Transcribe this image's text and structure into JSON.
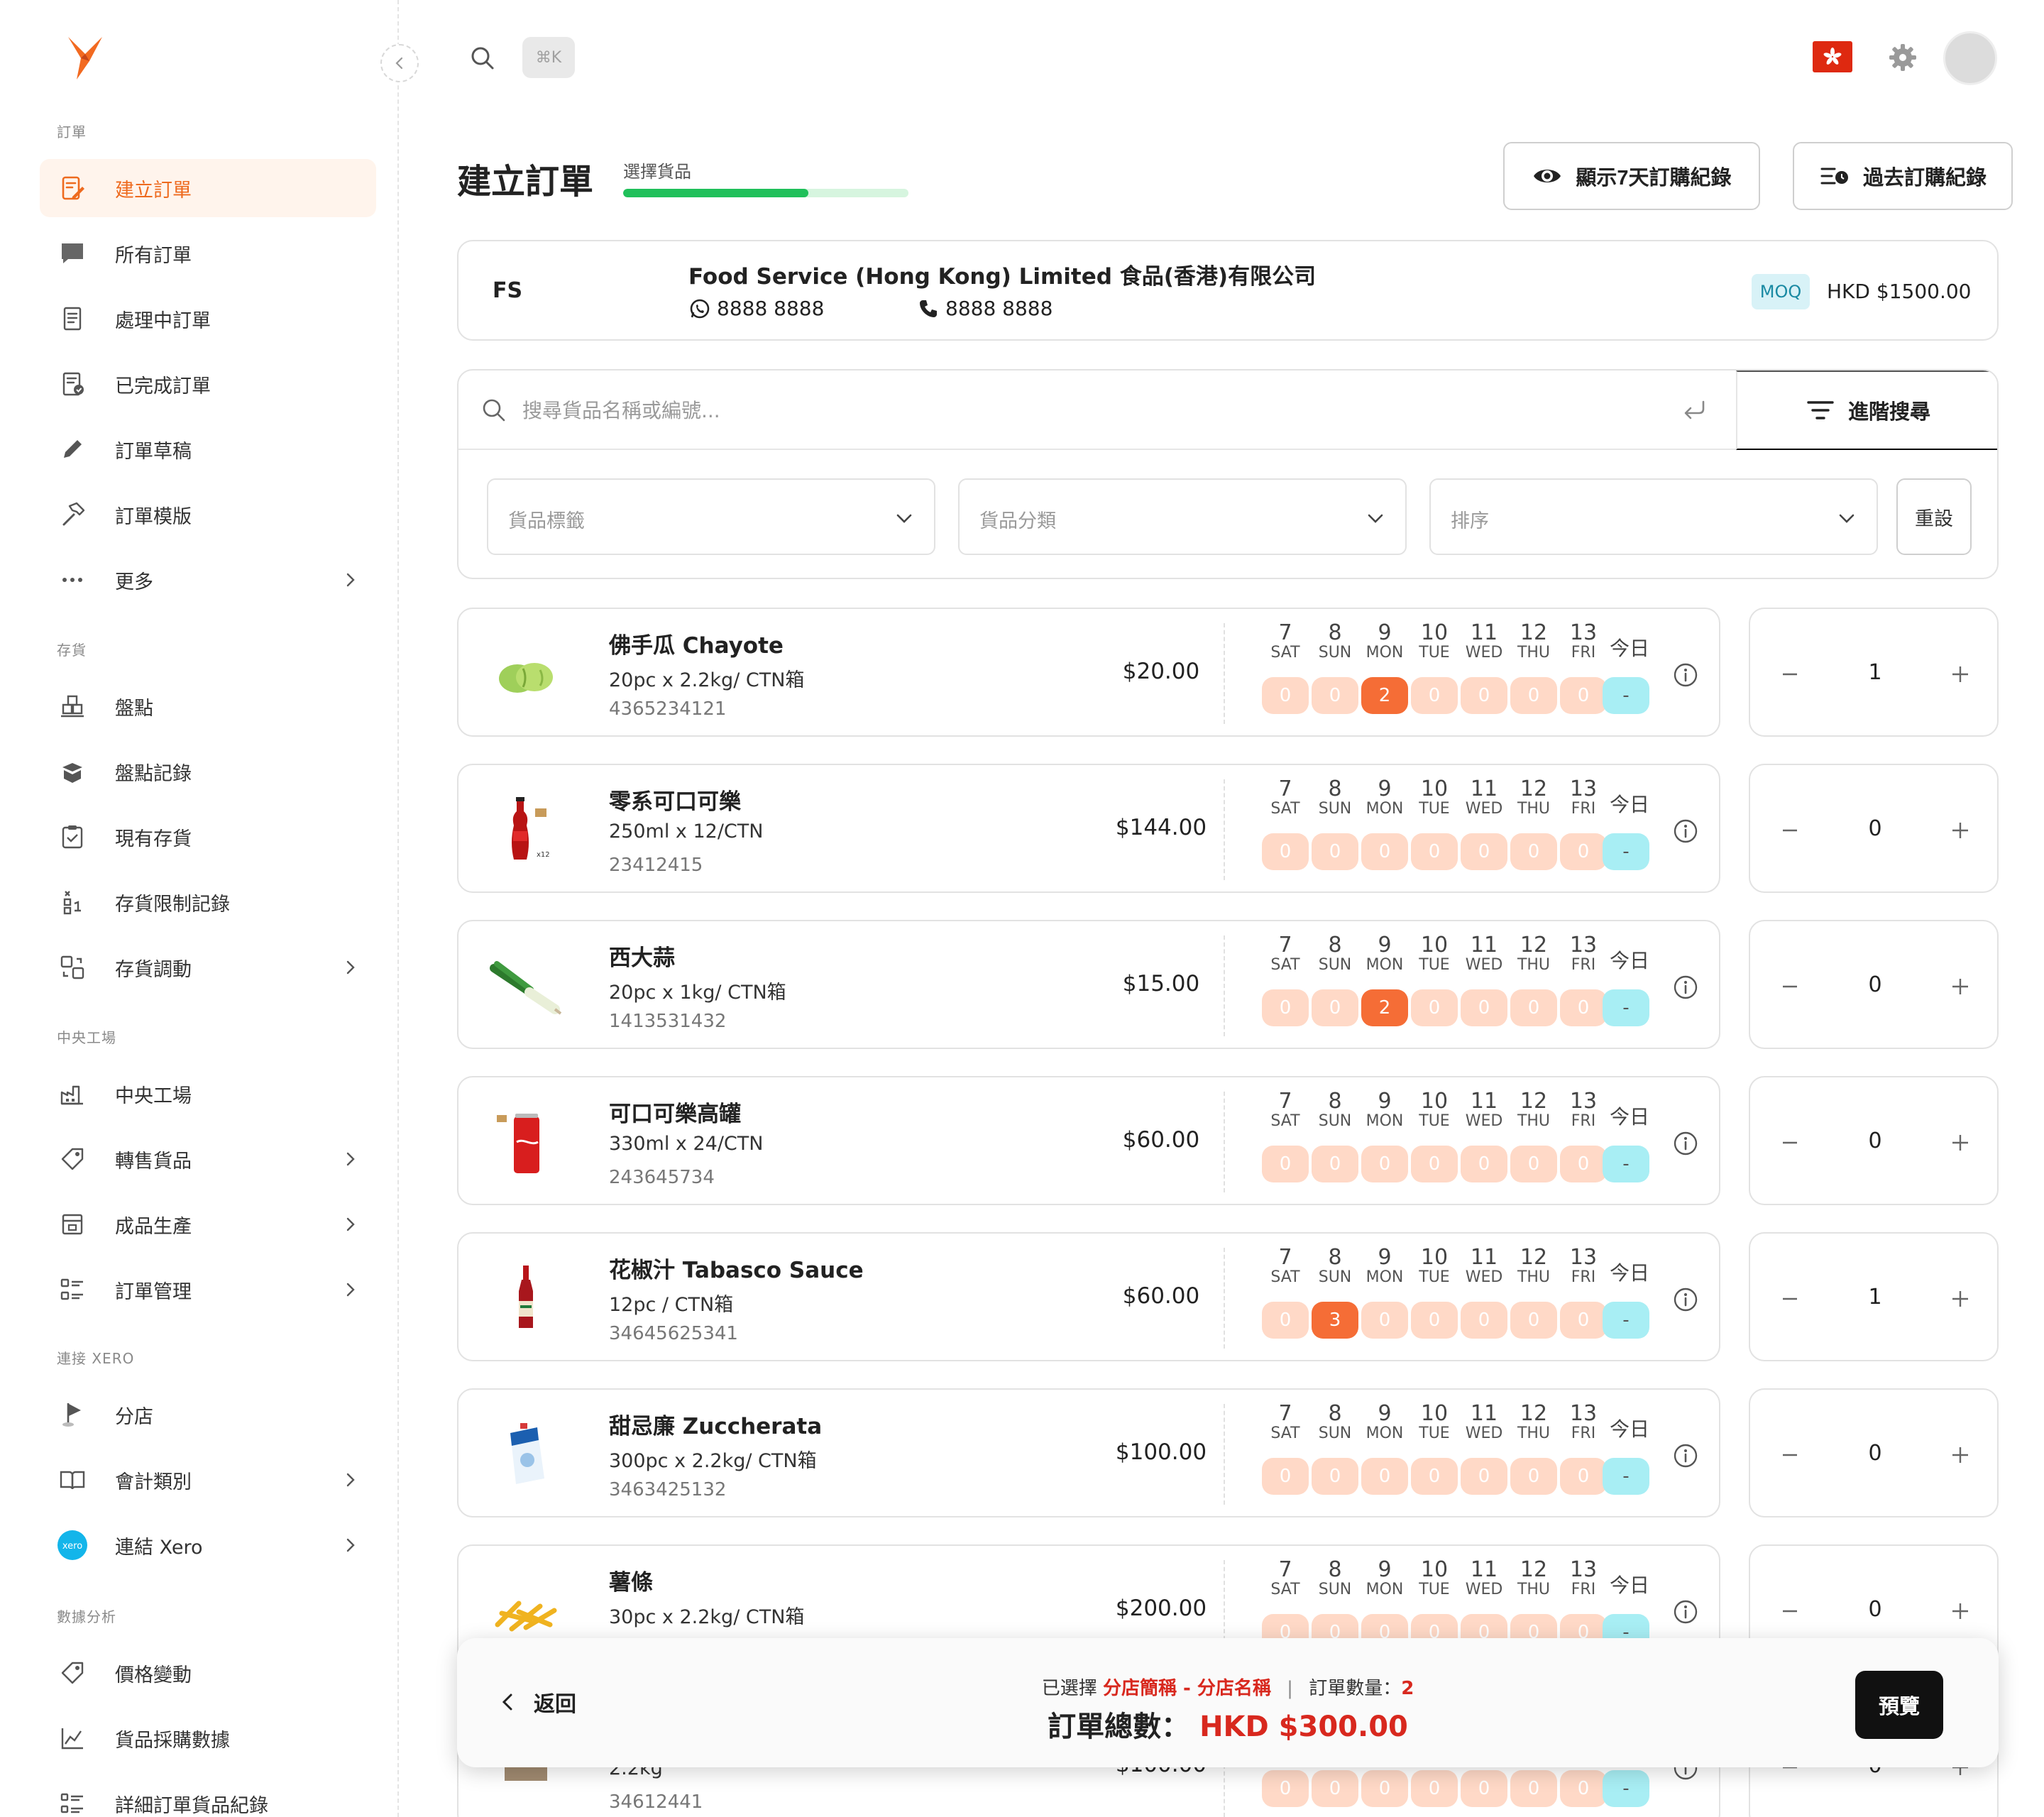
{
  "sidebar": {
    "sections": [
      {
        "title": "訂單",
        "items": [
          {
            "label": "建立訂單",
            "icon": "order-edit-icon",
            "active": true
          },
          {
            "label": "所有訂單",
            "icon": "chat-box-icon"
          },
          {
            "label": "處理中訂單",
            "icon": "receipt-icon"
          },
          {
            "label": "已完成訂單",
            "icon": "receipt-check-icon"
          },
          {
            "label": "訂單草稿",
            "icon": "pencil-icon"
          },
          {
            "label": "訂單模版",
            "icon": "hammer-icon"
          },
          {
            "label": "更多",
            "icon": "more-dots-icon",
            "chevron": true
          }
        ]
      },
      {
        "title": "存貨",
        "items": [
          {
            "label": "盤點",
            "icon": "stocktake-icon"
          },
          {
            "label": "盤點記錄",
            "icon": "box-open-icon"
          },
          {
            "label": "現有存貨",
            "icon": "clipboard-check-icon"
          },
          {
            "label": "存貨限制記錄",
            "icon": "limit-record-icon"
          },
          {
            "label": "存貨調動",
            "icon": "transfer-icon",
            "chevron": true
          }
        ]
      },
      {
        "title": "中央工場",
        "items": [
          {
            "label": "中央工場",
            "icon": "factory-icon"
          },
          {
            "label": "轉售貨品",
            "icon": "tag-icon",
            "chevron": true
          },
          {
            "label": "成品生產",
            "icon": "production-icon",
            "chevron": true
          },
          {
            "label": "訂單管理",
            "icon": "list-manage-icon",
            "chevron": true
          }
        ]
      },
      {
        "title": "連接 XERO",
        "items": [
          {
            "label": "分店",
            "icon": "flag-pin-icon"
          },
          {
            "label": "會計類別",
            "icon": "book-icon",
            "chevron": true
          },
          {
            "label": "連結 Xero",
            "icon": "xero-logo-icon",
            "chevron": true
          }
        ]
      },
      {
        "title": "數據分析",
        "items": [
          {
            "label": "價格變動",
            "icon": "price-tag-icon"
          },
          {
            "label": "貨品採購數據",
            "icon": "line-chart-icon"
          },
          {
            "label": "詳細訂單貨品紀錄",
            "icon": "detail-list-icon"
          }
        ]
      }
    ]
  },
  "topbar": {
    "shortcut": "⌘K"
  },
  "header": {
    "title": "建立訂單",
    "step_label": "選擇貨品",
    "step_progress": 0.65,
    "btn_7day": "顯示7天訂購紀錄",
    "btn_history": "過去訂購紀錄"
  },
  "supplier": {
    "code": "FS",
    "name": "Food Service (Hong Kong) Limited 食品(香港)有限公司",
    "whatsapp": "8888 8888",
    "phone": "8888 8888",
    "moq_label": "MOQ",
    "moq_value": "HKD $1500.00"
  },
  "search": {
    "placeholder": "搜尋貨品名稱或編號...",
    "advanced_label": "進階搜尋",
    "filter_tag": "貨品標籤",
    "filter_category": "貨品分類",
    "filter_sort": "排序",
    "reset_label": "重設"
  },
  "days": [
    {
      "num": "7",
      "name": "SAT"
    },
    {
      "num": "8",
      "name": "SUN"
    },
    {
      "num": "9",
      "name": "MON"
    },
    {
      "num": "10",
      "name": "TUE"
    },
    {
      "num": "11",
      "name": "WED"
    },
    {
      "num": "12",
      "name": "THU"
    },
    {
      "num": "13",
      "name": "FRI"
    }
  ],
  "today_label": "今日",
  "today_value": "-",
  "products": [
    {
      "name": "佛手瓜 Chayote",
      "spec": "20pc x 2.2kg/ CTN箱",
      "code": "4365234121",
      "price": "$20.00",
      "history": [
        "0",
        "0",
        "2",
        "0",
        "0",
        "0",
        "0"
      ],
      "qty": "1",
      "image": "chayote"
    },
    {
      "name": "零系可口可樂",
      "spec": "250ml x 12/CTN",
      "code": "23412415",
      "price": "$144.00",
      "history": [
        "0",
        "0",
        "0",
        "0",
        "0",
        "0",
        "0"
      ],
      "qty": "0",
      "image": "cola-bottle"
    },
    {
      "name": "西大蒜",
      "spec": "20pc x 1kg/ CTN箱",
      "code": "1413531432",
      "price": "$15.00",
      "history": [
        "0",
        "0",
        "2",
        "0",
        "0",
        "0",
        "0"
      ],
      "qty": "0",
      "image": "leek"
    },
    {
      "name": "可口可樂高罐",
      "spec": "330ml x 24/CTN",
      "code": "243645734",
      "price": "$60.00",
      "history": [
        "0",
        "0",
        "0",
        "0",
        "0",
        "0",
        "0"
      ],
      "qty": "0",
      "image": "cola-can"
    },
    {
      "name": "花椒汁 Tabasco Sauce",
      "spec": "12pc / CTN箱",
      "code": "34645625341",
      "price": "$60.00",
      "history": [
        "0",
        "3",
        "0",
        "0",
        "0",
        "0",
        "0"
      ],
      "qty": "1",
      "image": "tabasco"
    },
    {
      "name": "甜忌廉 Zuccherata",
      "spec": "300pc x 2.2kg/ CTN箱",
      "code": "3463425132",
      "price": "$100.00",
      "history": [
        "0",
        "0",
        "0",
        "0",
        "0",
        "0",
        "0"
      ],
      "qty": "0",
      "image": "cream-box"
    },
    {
      "name": "薯條",
      "spec": "30pc x 2.2kg/ CTN箱",
      "code": "",
      "price": "$200.00",
      "history": [
        "0",
        "0",
        "0",
        "0",
        "0",
        "0",
        "0"
      ],
      "qty": "0",
      "image": "fries"
    },
    {
      "name": "",
      "spec": "2.2kg",
      "code": "34612441",
      "price": "$100.00",
      "history": [
        "0",
        "0",
        "0",
        "0",
        "0",
        "0",
        "0"
      ],
      "qty": "0",
      "image": "box"
    }
  ],
  "footer": {
    "back_label": "返回",
    "selected_prefix": "已選擇",
    "selected_branch": "分店簡稱 - 分店名稱",
    "separator": "|",
    "count_label": "訂單數量：",
    "count_value": "2",
    "total_label": "訂單總數：",
    "total_value": "HKD $300.00",
    "preview_label": "預覽"
  },
  "colors": {
    "accent": "#ee6a1e",
    "history_empty": "#ffd9c7",
    "history_filled": "#f56d36",
    "today": "#a8eef4",
    "progress": "#20c05a",
    "total_red": "#d8281e"
  }
}
